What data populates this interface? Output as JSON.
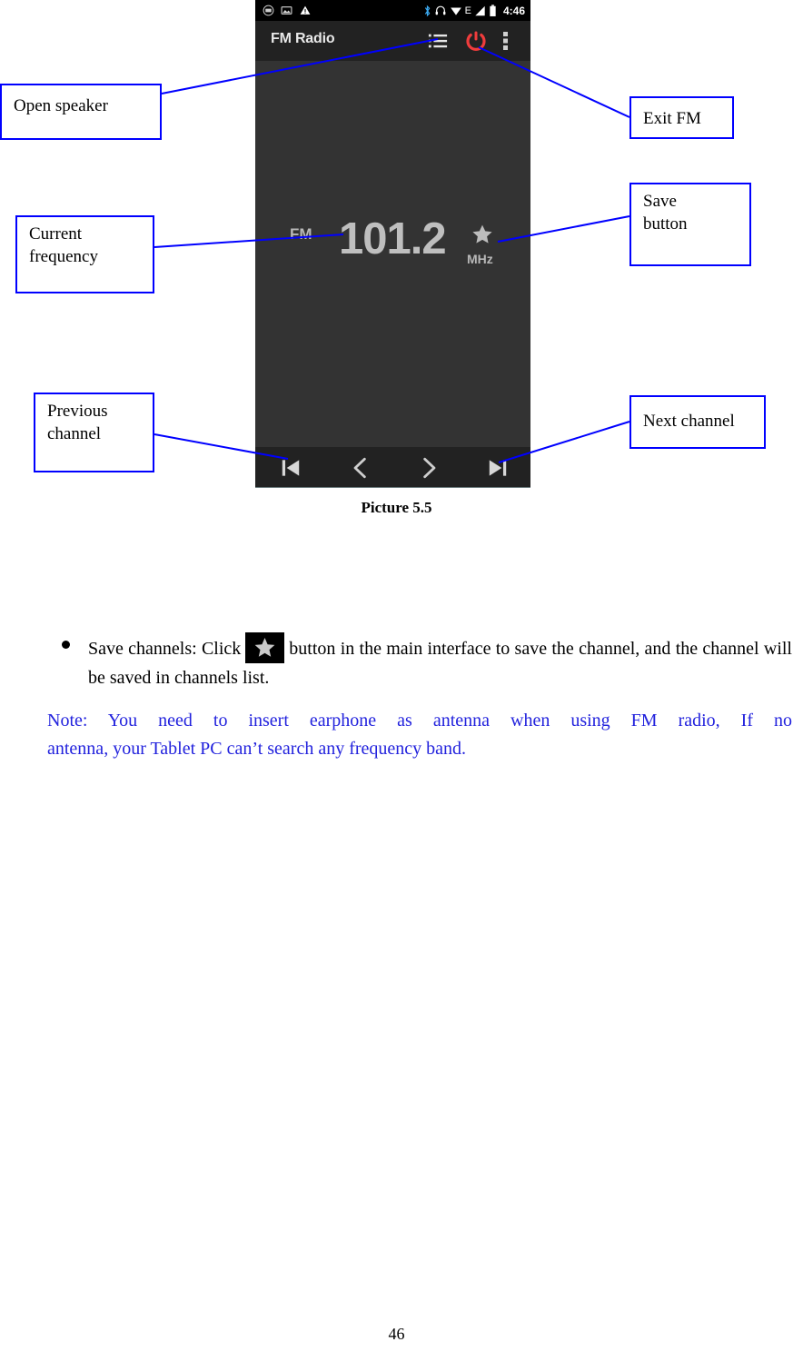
{
  "phone": {
    "status_bar": {
      "left_icons": [
        "fm-radio-icon",
        "image-icon",
        "warning-icon"
      ],
      "right_icons": [
        "bluetooth-icon",
        "headphones-icon",
        "wifi-icon",
        "edge-network-icon",
        "signal-icon",
        "battery-icon"
      ],
      "network_label": "E",
      "time": "4:46"
    },
    "toolbar": {
      "title": "FM Radio",
      "icons": [
        "channel-list-icon",
        "power-icon",
        "overflow-menu-icon"
      ],
      "power_color": "#f03c3c"
    },
    "display": {
      "band_label": "FM",
      "frequency": "101.2",
      "unit_label": "MHz",
      "save_star_icon": "star-icon"
    },
    "controls": [
      {
        "name": "skip-previous-button",
        "icon": "skip-previous-icon"
      },
      {
        "name": "tune-down-button",
        "icon": "chevron-left-icon"
      },
      {
        "name": "tune-up-button",
        "icon": "chevron-right-icon"
      },
      {
        "name": "skip-next-button",
        "icon": "skip-next-icon"
      }
    ]
  },
  "callouts": {
    "open_speaker": "Open speaker",
    "current_frequency": "Current\nfrequency",
    "current_frequency_line1": "Current",
    "current_frequency_line2": "frequency",
    "previous_channel_line1": "Previous",
    "previous_channel_line2": "channel",
    "exit_fm": "Exit FM",
    "save_button_line1": "Save",
    "save_button_line2": "button",
    "next_channel": "Next channel",
    "border_color": "#0000ff"
  },
  "caption": "Picture 5.5",
  "body": {
    "bullet_pre": "Save channels: Click",
    "bullet_post": "button in the main interface to save the channel, and the channel will be saved in channels list.",
    "note_line1": "Note: You need to insert earphone as antenna when using FM radio, If no",
    "note_line2": "antenna, your Tablet PC can’t search any frequency band.",
    "note_color": "#2222dd"
  },
  "page_number": "46"
}
